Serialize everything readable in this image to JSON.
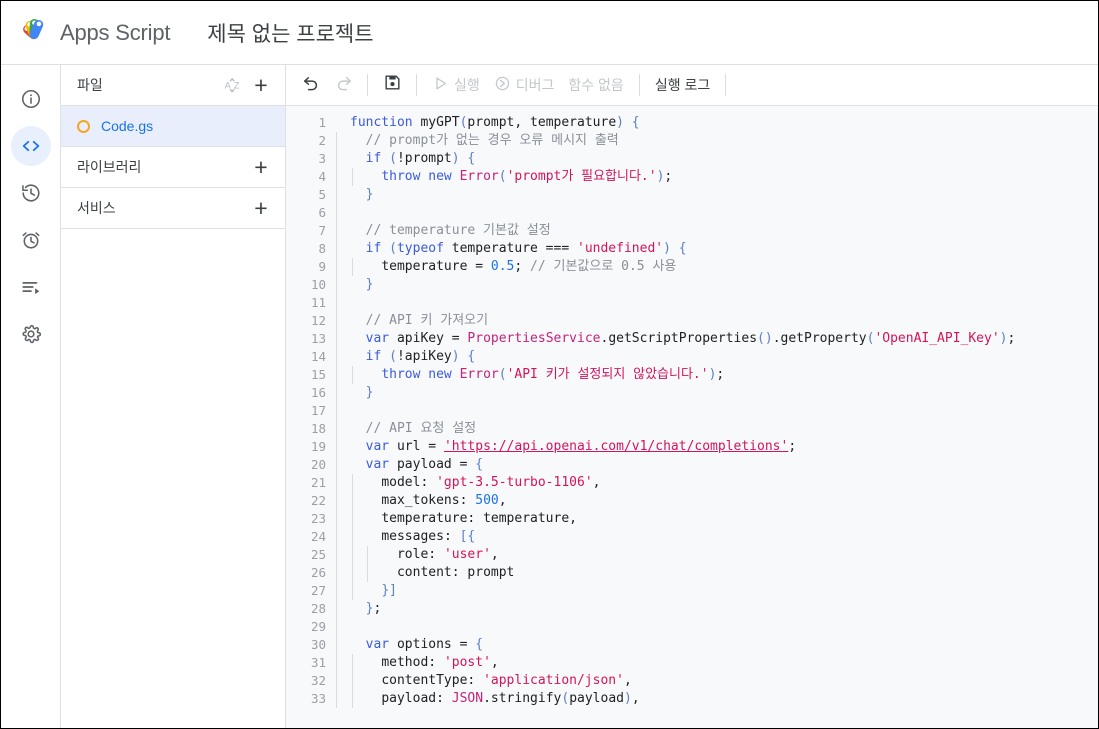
{
  "header": {
    "logo_name": "apps-script-logo",
    "brand": "Apps Script",
    "project_title": "제목 없는 프로젝트"
  },
  "rail": {
    "items": [
      {
        "icon": "info-icon",
        "name": "overview",
        "active": false
      },
      {
        "icon": "code-icon",
        "name": "editor",
        "active": true
      },
      {
        "icon": "history-icon",
        "name": "project-history",
        "active": false
      },
      {
        "icon": "alarm-clock-icon",
        "name": "triggers",
        "active": false
      },
      {
        "icon": "executions-icon",
        "name": "executions",
        "active": false
      },
      {
        "icon": "gear-icon",
        "name": "project-settings",
        "active": false
      }
    ]
  },
  "file_panel": {
    "files_label": "파일",
    "sort_icon": "sort-az-icon",
    "add_file_label": "+",
    "file": {
      "name": "Code.gs",
      "status_icon": "orange-circle-icon"
    },
    "libraries_label": "라이브러리",
    "add_library_label": "+",
    "services_label": "서비스",
    "add_service_label": "+"
  },
  "toolbar": {
    "undo_icon": "undo-icon",
    "redo_icon": "redo-icon",
    "save_icon": "save-icon",
    "run_label": "실행",
    "debug_label": "디버그",
    "function_select_label": "함수 없음",
    "execution_log_label": "실행 로그"
  },
  "colors": {
    "accent": "#1a73e8",
    "active_bg": "#e8f0fe",
    "file_selected_bg": "#e8eefc",
    "editor_bg": "#f8f9fb",
    "file_dot": "#f5a623",
    "keyword": "#3b5bdb",
    "string": "#d4145a",
    "comment": "#8a8f98",
    "number": "#1a73e8",
    "class": "#c5227a"
  },
  "code": {
    "language": "javascript",
    "first_line": 1,
    "last_visible_line": 33,
    "lines": [
      "function myGPT(prompt, temperature) {",
      "  // prompt가 없는 경우 오류 메시지 출력",
      "  if (!prompt) {",
      "    throw new Error('prompt가 필요합니다.');",
      "  }",
      "",
      "  // temperature 기본값 설정",
      "  if (typeof temperature === 'undefined') {",
      "    temperature = 0.5; // 기본값으로 0.5 사용",
      "  }",
      "",
      "  // API 키 가져오기",
      "  var apiKey = PropertiesService.getScriptProperties().getProperty('OpenAI_API_Key');",
      "  if (!apiKey) {",
      "    throw new Error('API 키가 설정되지 않았습니다.');",
      "  }",
      "",
      "  // API 요청 설정",
      "  var url = 'https://api.openai.com/v1/chat/completions';",
      "  var payload = {",
      "    model: 'gpt-3.5-turbo-1106',",
      "    max_tokens: 500,",
      "    temperature: temperature,",
      "    messages: [{",
      "      role: 'user',",
      "      content: prompt",
      "    }]",
      "  };",
      "",
      "  var options = {",
      "    method: 'post',",
      "    contentType: 'application/json',",
      "    payload: JSON.stringify(payload),"
    ]
  }
}
